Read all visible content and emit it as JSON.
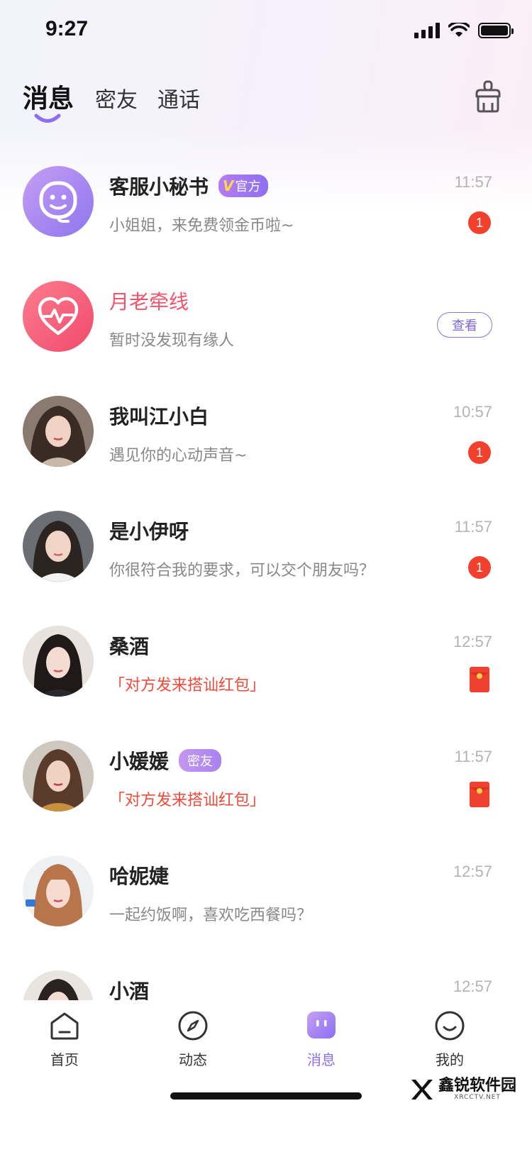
{
  "status_bar": {
    "time": "9:27"
  },
  "header": {
    "tabs": [
      {
        "label": "消息",
        "active": true
      },
      {
        "label": "密友",
        "active": false
      },
      {
        "label": "通话",
        "active": false
      }
    ],
    "clear_icon": "broom-icon"
  },
  "conversations": [
    {
      "name": "客服小秘书",
      "badge": "官方",
      "badge_prefix": "V",
      "preview": "小姐姐，来免费领金币啦~",
      "time": "11:57",
      "unread": "1",
      "avatar_icon": "support-agent-icon"
    },
    {
      "name": "月老牵线",
      "preview": "暂时没发现有缘人",
      "action_label": "查看",
      "avatar_icon": "heartbeat-icon"
    },
    {
      "name": "我叫江小白",
      "preview": "遇见你的心动声音~",
      "time": "10:57",
      "unread": "1"
    },
    {
      "name": "是小伊呀",
      "preview": "你很符合我的要求，可以交个朋友吗？",
      "time": "11:57",
      "unread": "1"
    },
    {
      "name": "桑酒",
      "preview": "「对方发来搭讪红包」",
      "time": "12:57",
      "attachment_icon": "red-packet-icon"
    },
    {
      "name": "小媛媛",
      "badge": "密友",
      "preview": "「对方发来搭讪红包」",
      "time": "11:57",
      "attachment_icon": "red-packet-icon"
    },
    {
      "name": "哈妮婕",
      "preview": "一起约饭啊，喜欢吃西餐吗？",
      "time": "12:57"
    },
    {
      "name": "小酒",
      "time": "12:57"
    }
  ],
  "bottom_nav": [
    {
      "label": "首页",
      "icon": "home-icon"
    },
    {
      "label": "动态",
      "icon": "compass-icon"
    },
    {
      "label": "消息",
      "icon": "message-icon",
      "active": true
    },
    {
      "label": "我的",
      "icon": "smile-icon"
    }
  ],
  "watermark": {
    "text": "鑫锐软件园",
    "sub": "XRCCTV.NET"
  },
  "colors": {
    "accent": "#8b6ff0",
    "unread": "#f2402c",
    "pink": "#f0566b",
    "red_text": "#ef4a3a"
  }
}
